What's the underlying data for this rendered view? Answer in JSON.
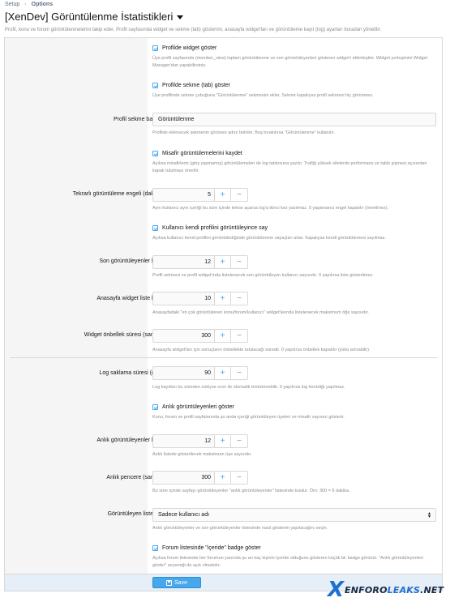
{
  "breadcrumb": {
    "items": [
      "Setup",
      "Options"
    ]
  },
  "page": {
    "title": "[XenDev] Görüntülenme İstatistikleri",
    "description": "Profil, konu ve forum görüntülenmelerini takip eder. Profil sayfasında widget ve sekme (tab) gösterimi, anasayfa widget'ları ve görüntüleme kayıt (log) ayarları buradan yönetilir."
  },
  "options": {
    "profile_widget": {
      "label": "Profilde widget göster",
      "hint": "Üye profil sayfasında (member_view) toplam görüntülenme ve son görüntüleyenleri gösteren widget'ı etkinleştirir. Widget yerleşimini Widget Manager'dan yapabilirsiniz."
    },
    "profile_tab": {
      "label": "Profilde sekme (tab) göster",
      "hint": "Üye profilinde sekme çubuğuna \"Görüntülenme\" sekmesini ekler. Sekme kapalıysa profil sekmesi hiç görünmez."
    },
    "tab_title": {
      "label": "Profil sekme başlığı:",
      "value": "Görüntülenme",
      "hint": "Profilde eklenecek sekmenin görünen adını belirler. Boş bırakılırsa \"Görüntülenme\" kullanılır."
    },
    "log_guests": {
      "label": "Misafir görüntülemelerini kaydet",
      "hint": "Açıksa misafirlerin (giriş yapmamış) görüntülemeleri de log tablosuna yazılır. Trafiği yüksek sitelerde performans ve tablo şişmesi açısından kapalı tutulması önerilir."
    },
    "repeat_block": {
      "label": "Tekrarlı görüntüleme engeli (dakika):",
      "value": "5",
      "hint": "Aynı kullanıcı aynı içeriği bu süre içinde tekrar açarsa log'a ikinci kez yazılmaz. 0 yaparsanız engel kapatılır (önerilmez)."
    },
    "count_own": {
      "label": "Kullanıcı kendi profilini görüntüleyince say",
      "hint": "Açıksa kullanıcı kendi profilini görüntülediğinde görüntülenme sayaçları artar. Kapalıysa kendi görüntülemesi sayılmaz."
    },
    "recent_limit": {
      "label": "Son görüntüleyenler limiti:",
      "value": "12",
      "hint": "Profil sekmesi ve profil widget'ında listelenecek son görüntüleyen kullanıcı sayısıdır. 0 yapılırsa liste gösterilmez."
    },
    "home_widget_limit": {
      "label": "Anasayfa widget liste limiti:",
      "value": "10",
      "hint": "Anasayfadaki \"en çok görüntülenen konu/forum/kullanıcı\" widget'larında listelenecek maksimum öğe sayısıdır."
    },
    "widget_cache": {
      "label": "Widget önbellek süresi (saniye):",
      "value": "300",
      "hint": "Anasayfa widget'ları için sonuçların önbellekte tutulacağı süredir. 0 yapılırsa önbellek kapatılır (yükü artırabilir)."
    },
    "log_retention": {
      "label": "Log saklama süresi (gün):",
      "value": "90",
      "hint": "Log kayıtları bu süreden eskiyse cron ile otomatik temizlenebilir. 0 yapılırsa log temizliği yapılmaz."
    },
    "live_viewers": {
      "label": "Anlık görüntüleyenleri göster",
      "hint": "Konu, forum ve profil sayfalarında şu anda içeriği görüntüleyen üyeleri ve misafir sayısını gösterir."
    },
    "live_limit": {
      "label": "Anlık görüntüleyenler limiti:",
      "value": "12",
      "hint": "Anlık listede gösterilecek maksimum üye sayısıdır."
    },
    "live_window": {
      "label": "Anlık pencere (saniye):",
      "value": "300",
      "hint": "Bu süre içinde sayfayı görüntüleyenler \"anlık görüntüleyenler\" listesinde tutulur. Örn: 300 = 5 dakika."
    },
    "viewer_style": {
      "label": "Görüntüleyen liste stili:",
      "value": "Sadece kullanıcı adı",
      "hint": "Anlık görüntüleyenler ve son görüntüleyenler listesinde nasıl gösterim yapılacağını seçin."
    },
    "forum_badge": {
      "label": "Forum listesinde \"içeride\" badge göster",
      "hint": "Açıksa forum listesinde her forumun yanında şu an kaç kişinin içeride olduğunu gösteren küçük bir badge görünür. \"Anlık görüntüleyenleri göster\" seçeneği de açık olmalıdır."
    }
  },
  "stepper": {
    "plus": "+",
    "minus": "−"
  },
  "footer": {
    "save_label": "Save"
  },
  "watermark": {
    "x": "X",
    "part1": "ENFORO",
    "part2": "LEAKS",
    "part3": ".NET"
  },
  "colors": {
    "accent": "#47a7eb",
    "footer_bg": "#e6eef7",
    "panel_bg": "#f5f5f5"
  }
}
